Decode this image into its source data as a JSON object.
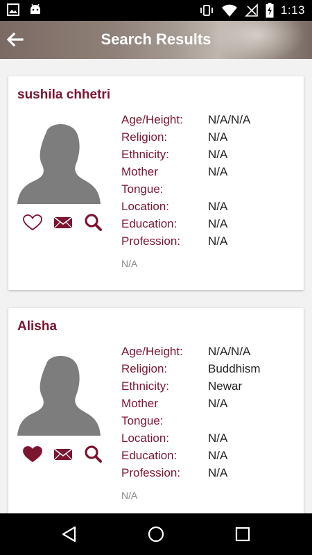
{
  "status_bar": {
    "time": "1:13",
    "left_icons": [
      "image-icon",
      "android-icon"
    ],
    "right_icons": [
      "bluetooth-vibrate-icon",
      "wifi-icon",
      "no-signal-icon",
      "battery-charging-icon"
    ]
  },
  "app_bar": {
    "title": "Search Results",
    "back_icon": "arrow-left-icon"
  },
  "theme": {
    "accent": "#7b1530",
    "text": "#222222",
    "muted": "#888888"
  },
  "results": [
    {
      "name": "sushila chhetri",
      "favorited": false,
      "fields": [
        {
          "label": "Age/Height:",
          "value": "N/A/N/A"
        },
        {
          "label": "Religion:",
          "value": "N/A"
        },
        {
          "label": "Ethnicity:",
          "value": "N/A"
        },
        {
          "label": "Mother",
          "value": "N/A"
        },
        {
          "label": "Tongue:",
          "value": ""
        },
        {
          "label": "Location:",
          "value": "N/A"
        },
        {
          "label": "Education:",
          "value": "N/A"
        },
        {
          "label": "Profession:",
          "value": "N/A"
        }
      ],
      "footer": "N/A"
    },
    {
      "name": "Alisha",
      "favorited": true,
      "fields": [
        {
          "label": "Age/Height:",
          "value": "N/A/N/A"
        },
        {
          "label": "Religion:",
          "value": "Buddhism"
        },
        {
          "label": "Ethnicity:",
          "value": "Newar"
        },
        {
          "label": "Mother",
          "value": "N/A"
        },
        {
          "label": "Tongue:",
          "value": ""
        },
        {
          "label": "Location:",
          "value": "N/A"
        },
        {
          "label": "Education:",
          "value": "N/A"
        },
        {
          "label": "Profession:",
          "value": "N/A"
        }
      ],
      "footer": "N/A"
    }
  ],
  "nav_bar": {
    "buttons": [
      "back-triangle-icon",
      "home-circle-icon",
      "recents-square-icon"
    ]
  }
}
